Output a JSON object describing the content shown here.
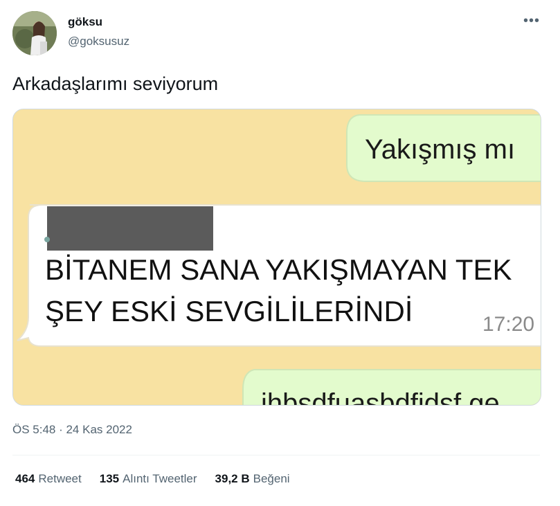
{
  "user": {
    "name": "göksu",
    "handle": "@goksusuz"
  },
  "tweet": {
    "text": "Arkadaşlarımı seviyorum",
    "timestamp": "ÖS 5:48 · 24 Kas 2022"
  },
  "media": {
    "bubble_top": "Yakışmış mı",
    "message_line1": "BİTANEM SANA YAKIŞMAYAN TEK",
    "message_line2": "ŞEY ESKİ SEVGİLİLERİNDİ",
    "message_time": "17:20",
    "bubble_bottom": "ihbsdfuasbdfidsf ge"
  },
  "stats": {
    "retweets_count": "464",
    "retweets_label": "Retweet",
    "quotes_count": "135",
    "quotes_label": "Alıntı Tweetler",
    "likes_count": "39,2 B",
    "likes_label": "Beğeni"
  },
  "icons": {
    "more": "more-horizontal-icon"
  },
  "colors": {
    "chat_background": "#f8e2a2",
    "sent_bubble": "#e3fbcd",
    "received_bubble": "#ffffff",
    "secondary_text": "#536471"
  }
}
